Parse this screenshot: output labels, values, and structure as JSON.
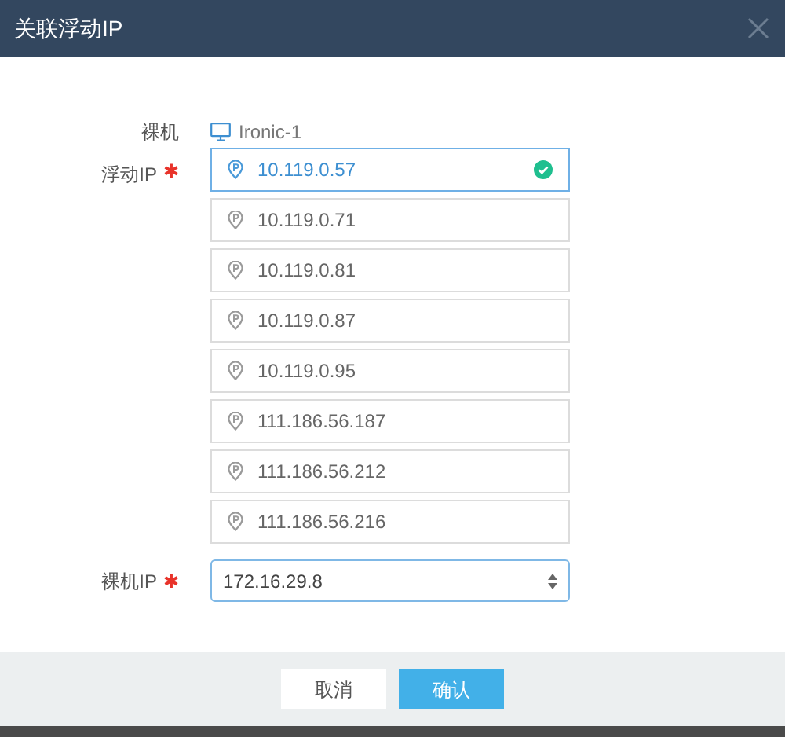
{
  "dialog": {
    "title": "关联浮动IP"
  },
  "bare_metal": {
    "label": "裸机",
    "value": "Ironic-1"
  },
  "floating_ip": {
    "label": "浮动IP",
    "required_mark": "✱",
    "options": [
      {
        "ip": "10.119.0.57",
        "selected": true
      },
      {
        "ip": "10.119.0.71",
        "selected": false
      },
      {
        "ip": "10.119.0.81",
        "selected": false
      },
      {
        "ip": "10.119.0.87",
        "selected": false
      },
      {
        "ip": "10.119.0.95",
        "selected": false
      },
      {
        "ip": "111.186.56.187",
        "selected": false
      },
      {
        "ip": "111.186.56.212",
        "selected": false
      },
      {
        "ip": "111.186.56.216",
        "selected": false
      }
    ]
  },
  "bare_metal_ip": {
    "label": "裸机IP",
    "required_mark": "✱",
    "value": "172.16.29.8"
  },
  "buttons": [
    {
      "label": "取消",
      "kind": "secondary"
    },
    {
      "label": "确认",
      "kind": "primary"
    }
  ]
}
